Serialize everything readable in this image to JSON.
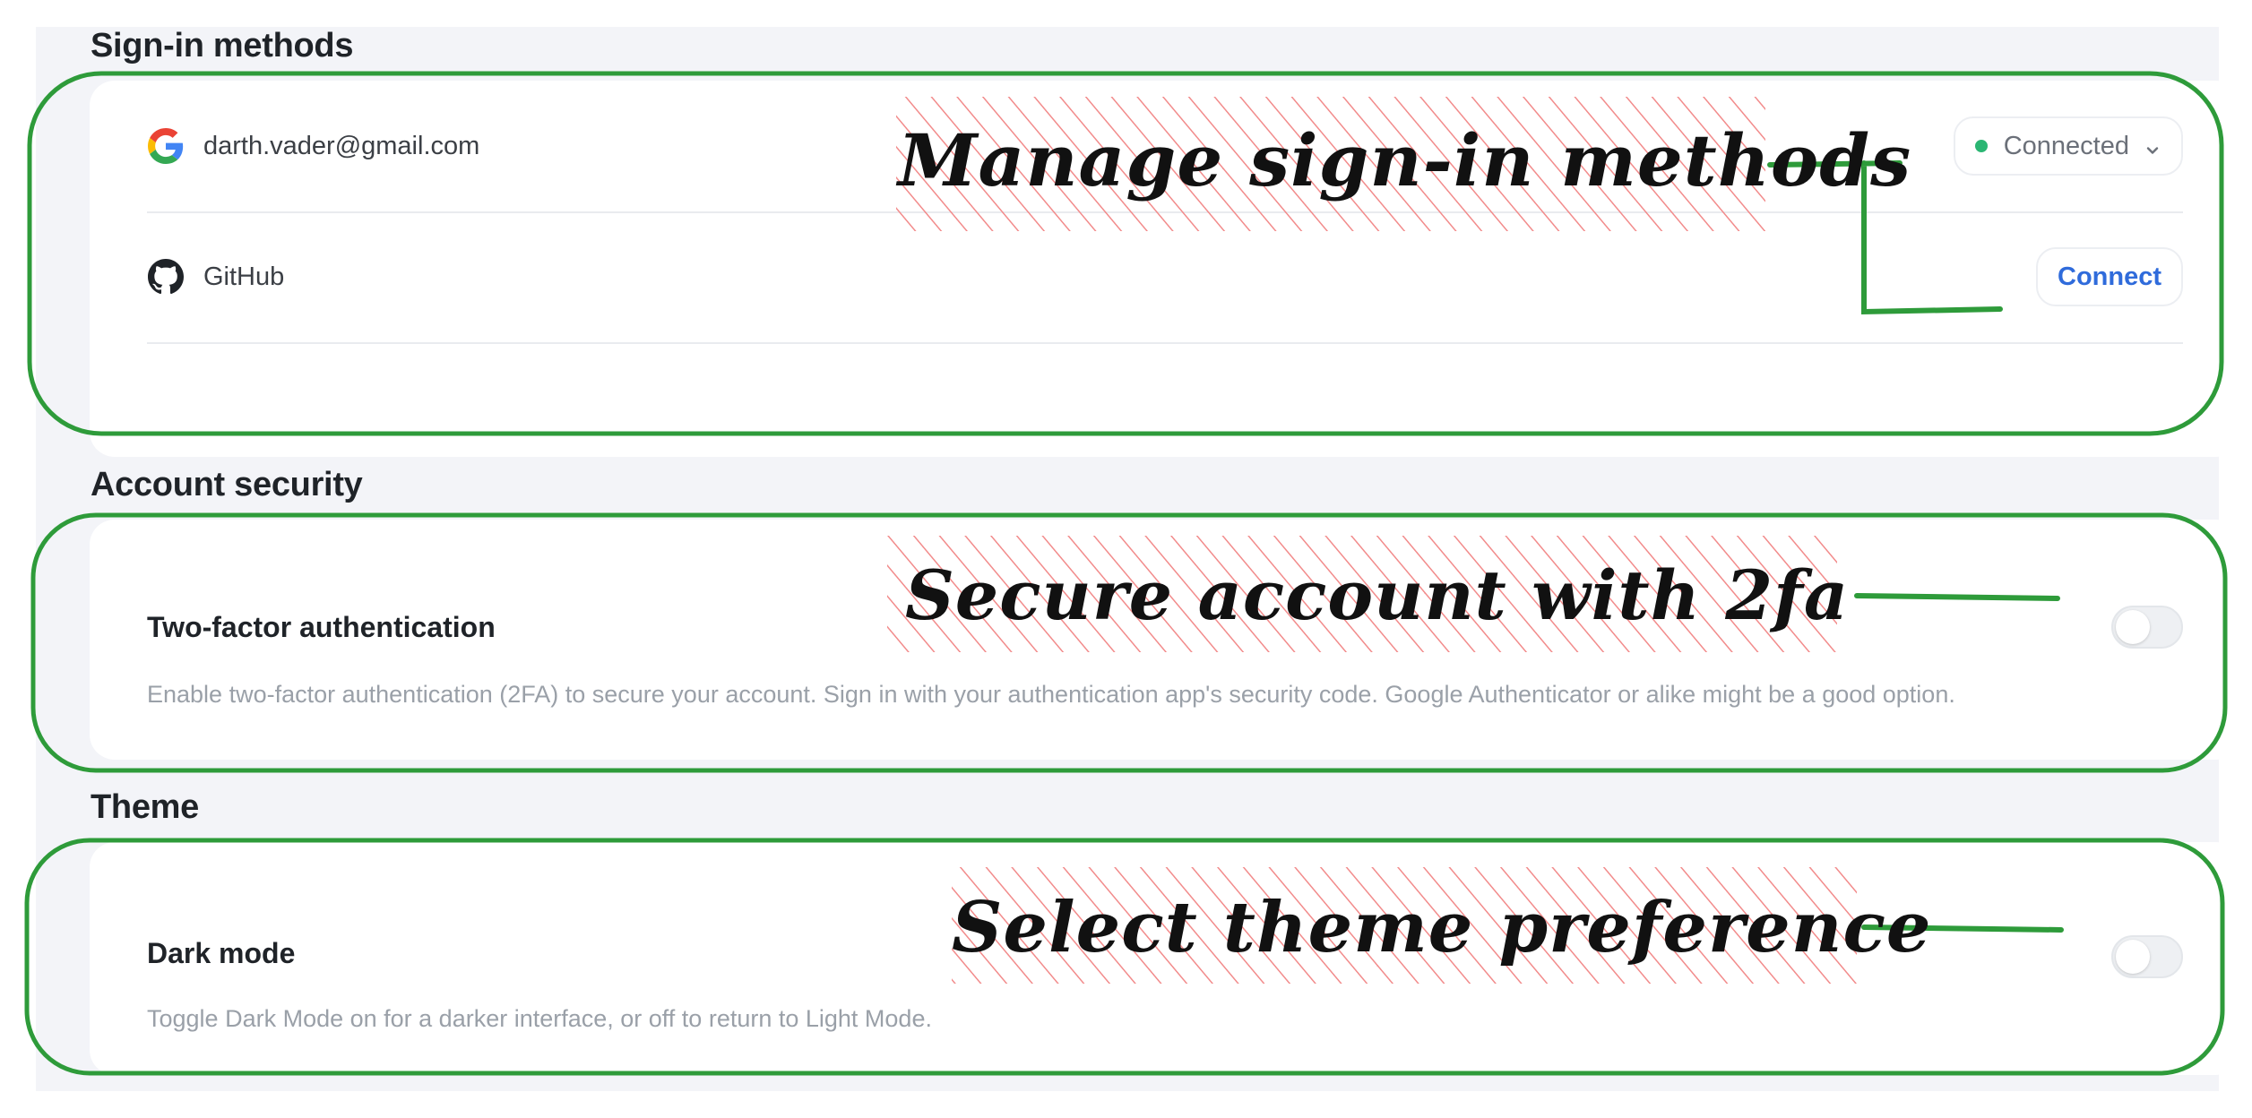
{
  "sections": {
    "signin": {
      "title": "Sign-in methods",
      "providers": [
        {
          "name": "darth.vader@gmail.com",
          "icon": "google-icon",
          "status": "Connected",
          "status_color": "#2bb673"
        },
        {
          "name": "GitHub",
          "icon": "github-icon",
          "action": "Connect",
          "action_color": "#2f6bdb"
        }
      ]
    },
    "security": {
      "title": "Account security",
      "two_factor": {
        "title": "Two-factor authentication",
        "description": "Enable two-factor authentication (2FA) to secure your account. Sign in with your authentication app's security code. Google Authenticator or alike might be a good option.",
        "enabled": false
      }
    },
    "theme": {
      "title": "Theme",
      "dark_mode": {
        "title": "Dark mode",
        "description": "Toggle Dark Mode on for a darker interface, or off to return to Light Mode.",
        "enabled": false
      }
    }
  },
  "annotations": {
    "signin": "Manage sign-in methods",
    "security": "Secure account with 2fa",
    "theme": "Select theme preference",
    "outline_color": "#2e9b3a",
    "hatch_color": "#f28b8b"
  }
}
